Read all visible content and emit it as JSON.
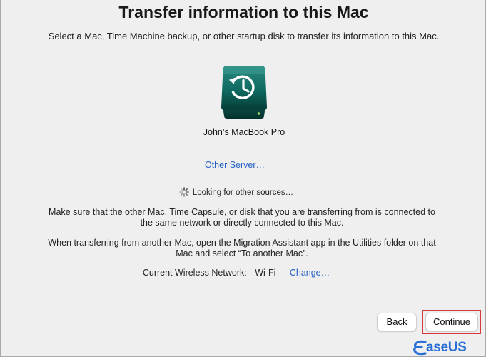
{
  "header": {
    "title": "Transfer information to this Mac",
    "subtitle": "Select a Mac, Time Machine backup, or other startup disk to transfer its information to this Mac."
  },
  "source": {
    "icon": "time-machine-disk-icon",
    "label": "John’s MacBook Pro"
  },
  "other_server_label": "Other Server…",
  "status": {
    "icon": "spinner-icon",
    "text": "Looking for other sources…"
  },
  "instructions": {
    "connection": "Make sure that the other Mac, Time Capsule, or disk that you are transferring from is connected to the same network or directly connected to this Mac.",
    "migration": "When transferring from another Mac, open the Migration Assistant app in the Utilities folder on that Mac and select “To another Mac”."
  },
  "network": {
    "label": "Current Wireless Network:",
    "value": "Wi-Fi",
    "change_label": "Change…"
  },
  "footer": {
    "back_label": "Back",
    "continue_label": "Continue"
  },
  "watermark": {
    "text": "aseUS",
    "brand": "EaseUS"
  },
  "colors": {
    "background": "#efefef",
    "link": "#2360c7",
    "highlight": "#d63a3a",
    "disk": "#0e5e57",
    "watermark": "#2a6fd6"
  }
}
